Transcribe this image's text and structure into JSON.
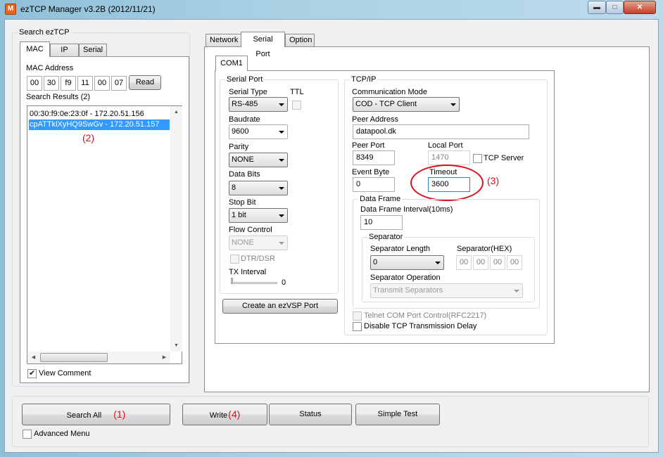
{
  "window": {
    "title": "ezTCP Manager v3.2B (2012/11/21)",
    "icon_letter": "M"
  },
  "search": {
    "group_title": "Search ezTCP",
    "tabs": [
      "MAC",
      "IP",
      "Serial"
    ],
    "mac_label": "MAC Address",
    "mac": [
      "00",
      "30",
      "f9",
      "11",
      "00",
      "07"
    ],
    "read_button": "Read",
    "results_label": "Search Results (2)",
    "results": [
      "00:30:f9:0e:23:0f - 172.20.51.156",
      "cpATTklXyHQ9SwGv - 172.20.51.157"
    ],
    "annotation": "(2)",
    "view_comment": "View Comment"
  },
  "main_tabs": [
    "Network",
    "Serial Port",
    "Option"
  ],
  "com_tab": "COM1",
  "serial": {
    "group_title": "Serial Port",
    "serial_type_label": "Serial Type",
    "ttl_label": "TTL",
    "serial_type": "RS-485",
    "baudrate_label": "Baudrate",
    "baudrate": "9600",
    "parity_label": "Parity",
    "parity": "NONE",
    "data_bits_label": "Data Bits",
    "data_bits": "8",
    "stop_bit_label": "Stop Bit",
    "stop_bit": "1 bit",
    "flow_control_label": "Flow Control",
    "flow_control": "NONE",
    "dtr_dsr": "DTR/DSR",
    "tx_interval_label": "TX Interval",
    "tx_interval": "0",
    "create_button": "Create an ezVSP Port"
  },
  "tcpip": {
    "group_title": "TCP/IP",
    "comm_mode_label": "Communication Mode",
    "comm_mode": "COD - TCP Client",
    "peer_address_label": "Peer Address",
    "peer_address": "datapool.dk",
    "peer_port_label": "Peer Port",
    "peer_port": "8349",
    "local_port_label": "Local Port",
    "local_port": "1470",
    "tcp_server": "TCP Server",
    "event_byte_label": "Event Byte",
    "event_byte": "0",
    "timeout_label": "Timeout",
    "timeout": "3600",
    "annotation": "(3)",
    "data_frame": {
      "group_title": "Data Frame",
      "interval_label": "Data Frame Interval(10ms)",
      "interval": "10",
      "separator": {
        "group_title": "Separator",
        "length_label": "Separator Length",
        "length": "0",
        "hex_label": "Separator(HEX)",
        "hex": [
          "00",
          "00",
          "00",
          "00"
        ],
        "operation_label": "Separator Operation",
        "operation": "Transmit Separators"
      }
    },
    "telnet": "Telnet COM Port Control(RFC2217)",
    "disable_delay": "Disable TCP Transmission Delay"
  },
  "bottom": {
    "search_all": "Search All",
    "search_all_annotation": "(1)",
    "write": "Write",
    "write_annotation": "(4)",
    "status": "Status",
    "simple_test": "Simple Test",
    "advanced_menu": "Advanced Menu"
  },
  "colors": {
    "selection": "#3399ff",
    "annotation": "#d8111b",
    "title_icon": "#e8661a"
  }
}
